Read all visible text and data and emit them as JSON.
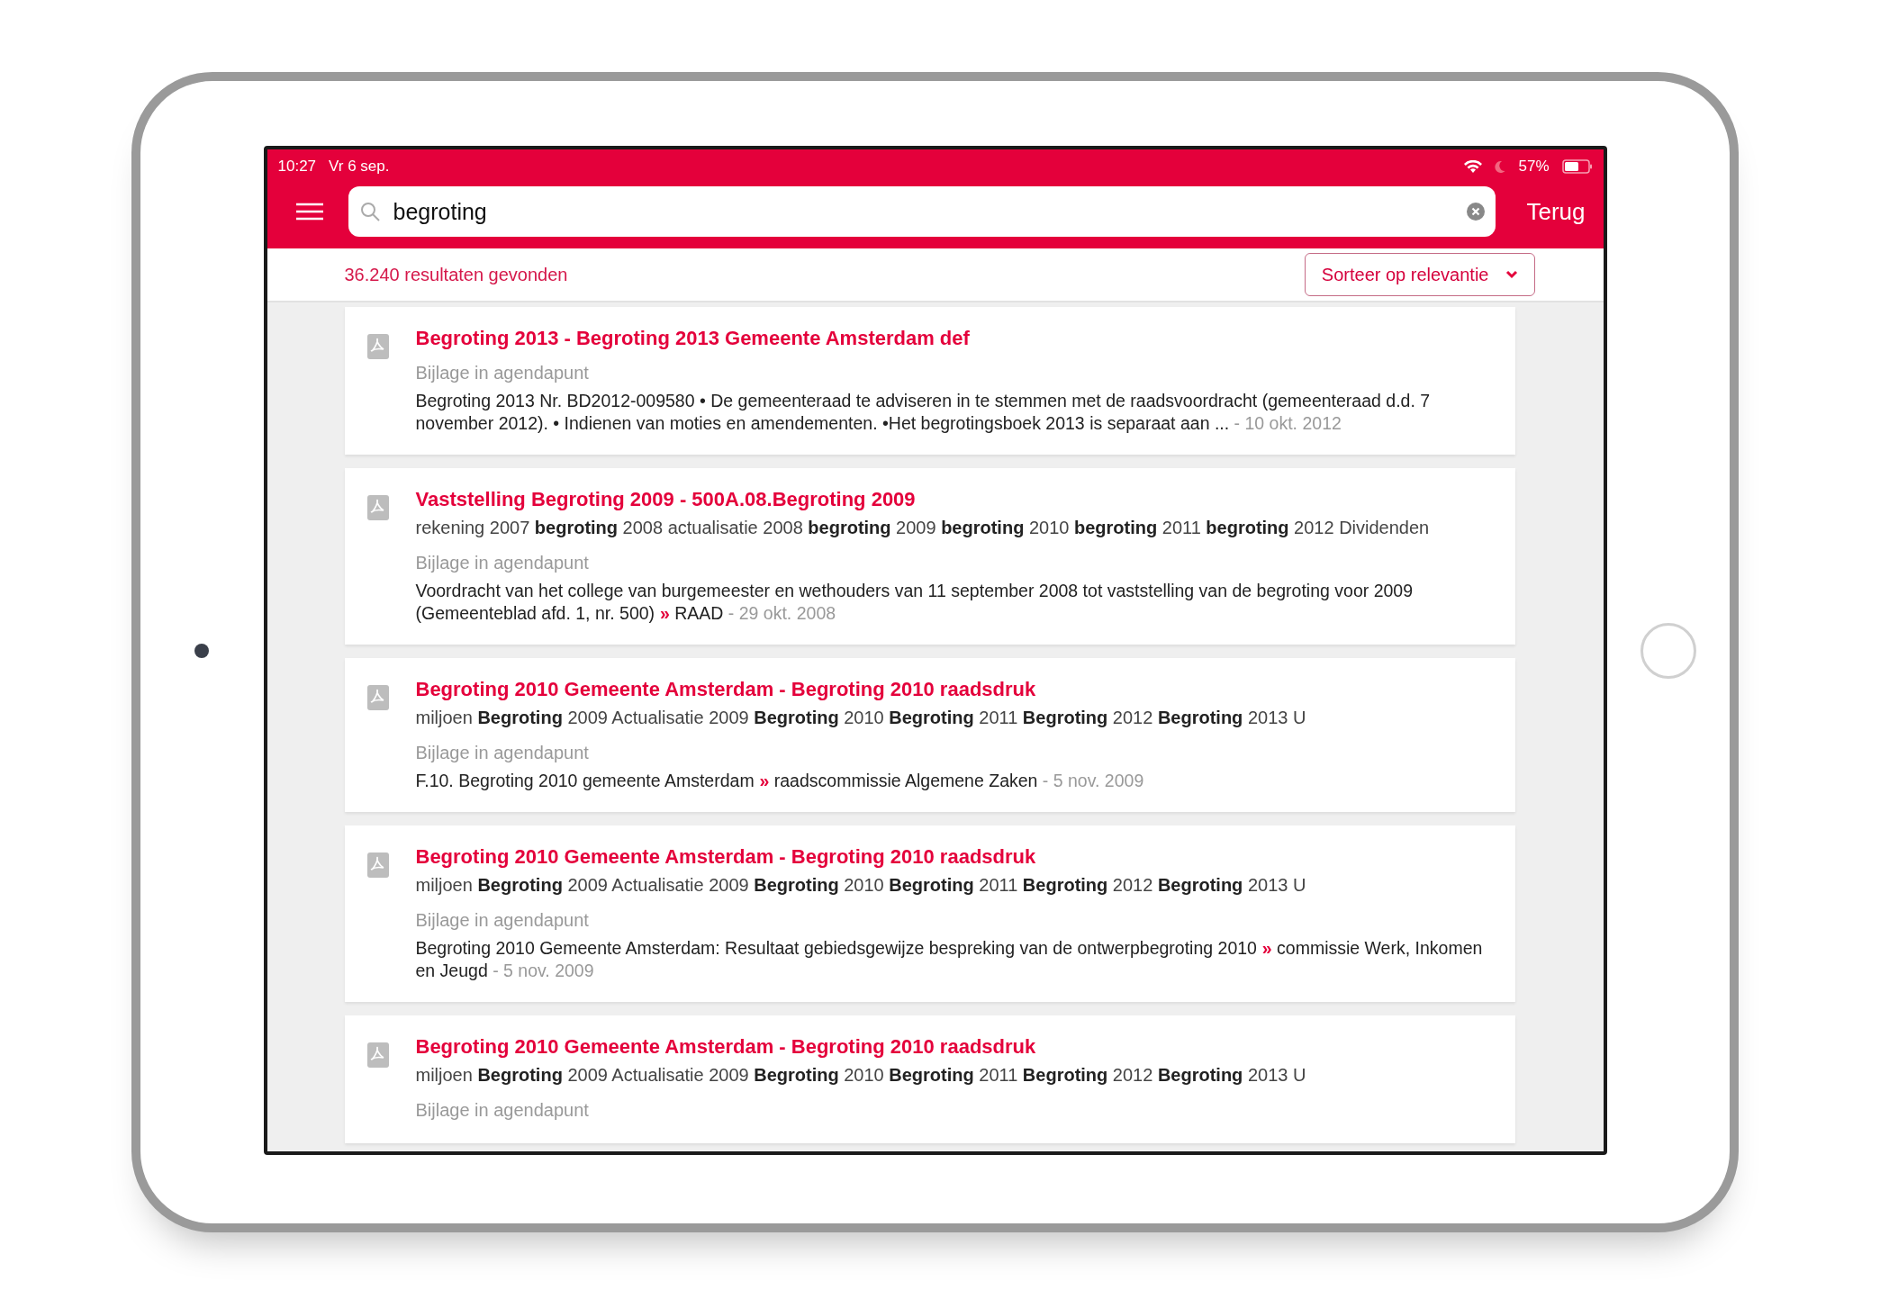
{
  "status_bar": {
    "time": "10:27",
    "date": "Vr 6 sep.",
    "battery": "57%"
  },
  "search": {
    "value": "begroting",
    "cancel": "Terug"
  },
  "results_count": "36.240 resultaten gevonden",
  "sort": {
    "label": "Sorteer op relevantie"
  },
  "results": [
    {
      "title": "Begroting 2013 - Begroting 2013 Gemeente Amsterdam def",
      "type": "Bijlage in agendapunt",
      "description": {
        "text": "Begroting 2013 Nr. BD2012-009580  •  De gemeenteraad te adviseren in te stemmen met de raadsvoordracht  (gemeenteraad d.d. 7 november  2012). • Indienen van moties en amendementen. •Het begrotingsboek 2013 is separaat aan ...",
        "date": "- 10 okt. 2012"
      }
    },
    {
      "title": "Vaststelling Begroting 2009 - 500A.08.Begroting 2009",
      "snippet": "rekening 2007 **begroting** 2008 actualisatie 2008 **begroting** 2009 **begroting** 2010 **begroting** 2011 **begroting** 2012 Dividenden",
      "type": "Bijlage in agendapunt",
      "description": {
        "text": "Voordracht van het college van burgemeester en wethouders van 11 september 2008 tot vaststelling van de begroting voor 2009 (Gemeenteblad afd. 1, nr. 500)",
        "separator": "»",
        "context": "RAAD",
        "date": "- 29 okt. 2008"
      }
    },
    {
      "title": "Begroting 2010 Gemeente Amsterdam - Begroting 2010 raadsdruk",
      "snippet": "miljoen **Begroting** 2009 Actualisatie 2009 **Begroting** 2010 **Begroting** 2011 **Begroting** 2012 **Begroting** 2013 U",
      "type": "Bijlage in agendapunt",
      "description": {
        "text": "F.10. Begroting 2010 gemeente Amsterdam",
        "separator": "»",
        "context": "raadscommissie Algemene Zaken",
        "date": "- 5 nov. 2009"
      }
    },
    {
      "title": "Begroting 2010 Gemeente Amsterdam - Begroting 2010 raadsdruk",
      "snippet": "miljoen **Begroting** 2009 Actualisatie 2009 **Begroting** 2010 **Begroting** 2011 **Begroting** 2012 **Begroting** 2013 U",
      "type": "Bijlage in agendapunt",
      "description": {
        "text": "Begroting 2010 Gemeente Amsterdam: Resultaat gebiedsgewijze bespreking van de ontwerpbegroting 2010",
        "separator": "»",
        "context": "commissie Werk, Inkomen en Jeugd",
        "date": "- 5 nov. 2009"
      }
    },
    {
      "title": "Begroting 2010 Gemeente Amsterdam - Begroting 2010 raadsdruk",
      "snippet": "miljoen **Begroting** 2009 Actualisatie 2009 **Begroting** 2010 **Begroting** 2011 **Begroting** 2012 **Begroting** 2013 U",
      "type": "Bijlage in agendapunt"
    }
  ]
}
